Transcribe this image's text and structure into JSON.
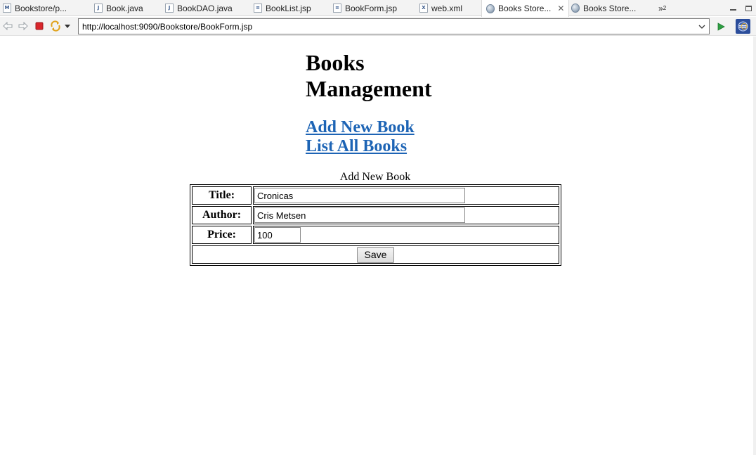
{
  "tabs": [
    {
      "label": "Bookstore/p...",
      "icon": "maven-pom-icon",
      "glyph": "M"
    },
    {
      "label": "Book.java",
      "icon": "java-file-icon",
      "glyph": "J"
    },
    {
      "label": "BookDAO.java",
      "icon": "java-file-icon",
      "glyph": "J"
    },
    {
      "label": "BookList.jsp",
      "icon": "jsp-file-icon",
      "glyph": "≡"
    },
    {
      "label": "BookForm.jsp",
      "icon": "jsp-file-icon",
      "glyph": "≡"
    },
    {
      "label": "web.xml",
      "icon": "xml-file-icon",
      "glyph": "X"
    },
    {
      "label": "Books Store...",
      "icon": "web-browser-icon",
      "active": true
    },
    {
      "label": "Books Store...",
      "icon": "web-browser-icon"
    }
  ],
  "tab_overflow": {
    "label": "»",
    "count": "2"
  },
  "browser": {
    "url": "http://localhost:9090/Bookstore/BookForm.jsp"
  },
  "page": {
    "title": "Books Management",
    "title_line1": "Books",
    "title_line2": "Management",
    "links": [
      "Add New Book",
      "List All Books"
    ],
    "form_caption": "Add New Book",
    "fields": [
      {
        "label": "Title:",
        "value": "Cronicas"
      },
      {
        "label": "Author:",
        "value": "Cris Metsen"
      },
      {
        "label": "Price:",
        "value": "100"
      }
    ],
    "save_label": "Save"
  },
  "colors": {
    "link": "#1d64b5",
    "stop_red": "#d9262b",
    "go_green": "#2ea043",
    "eclipse_blue": "#2b4d9b"
  }
}
